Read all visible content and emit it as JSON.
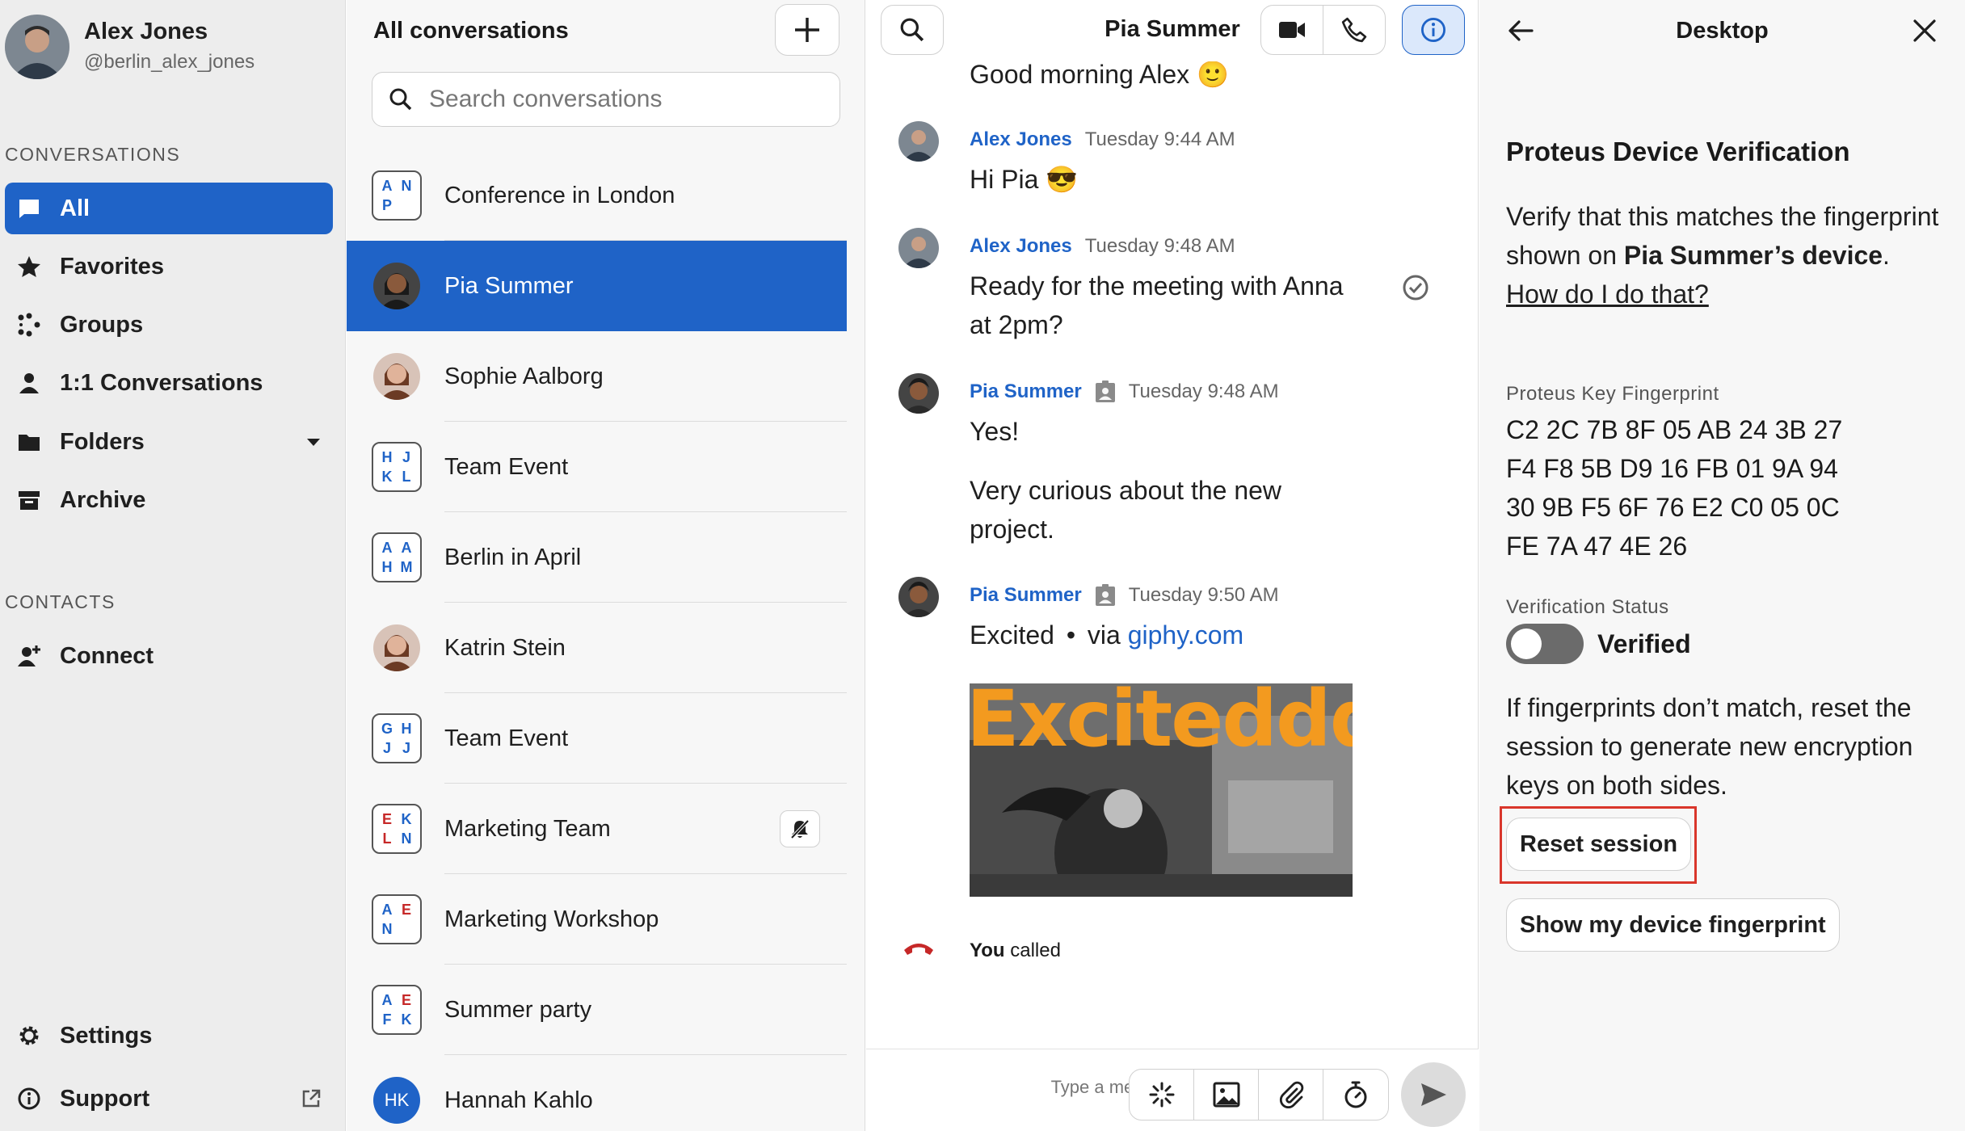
{
  "user": {
    "name": "Alex Jones",
    "handle": "@berlin_alex_jones"
  },
  "sidebar": {
    "conversations_label": "CONVERSATIONS",
    "items": [
      {
        "label": "All",
        "icon": "chat-bubble-icon",
        "active": true
      },
      {
        "label": "Favorites",
        "icon": "star-icon"
      },
      {
        "label": "Groups",
        "icon": "groups-icon"
      },
      {
        "label": "1:1 Conversations",
        "icon": "person-icon"
      },
      {
        "label": "Folders",
        "icon": "folder-icon"
      },
      {
        "label": "Archive",
        "icon": "archive-icon"
      }
    ],
    "contacts_label": "CONTACTS",
    "connect_label": "Connect",
    "settings_label": "Settings",
    "support_label": "Support"
  },
  "conversation_list": {
    "title": "All conversations",
    "search_placeholder": "Search conversations",
    "items": [
      {
        "name": "Conference in London",
        "type": "group",
        "initials": [
          "A",
          "N",
          "P",
          ""
        ],
        "colors": [
          "#1f63c7",
          "#1f63c7",
          "#1f63c7",
          "#1f63c7"
        ]
      },
      {
        "name": "Pia Summer",
        "type": "user",
        "active": true
      },
      {
        "name": "Sophie Aalborg",
        "type": "user"
      },
      {
        "name": "Team Event",
        "type": "group",
        "initials": [
          "H",
          "J",
          "K",
          "L"
        ],
        "colors": [
          "#1f63c7",
          "#1f63c7",
          "#1f63c7",
          "#1f63c7"
        ]
      },
      {
        "name": "Berlin in April",
        "type": "group",
        "initials": [
          "A",
          "A",
          "H",
          "M"
        ],
        "colors": [
          "#1f63c7",
          "#1f63c7",
          "#1f63c7",
          "#1f63c7"
        ]
      },
      {
        "name": "Katrin Stein",
        "type": "user"
      },
      {
        "name": "Team Event",
        "type": "group",
        "initials": [
          "G",
          "H",
          "J",
          "J"
        ],
        "colors": [
          "#1f63c7",
          "#1f63c7",
          "#1f63c7",
          "#1f63c7"
        ]
      },
      {
        "name": "Marketing Team",
        "type": "group",
        "initials": [
          "E",
          "K",
          "L",
          "N"
        ],
        "colors": [
          "#c62828",
          "#1f63c7",
          "#c62828",
          "#1f63c7"
        ],
        "muted": true
      },
      {
        "name": "Marketing Workshop",
        "type": "group",
        "initials": [
          "A",
          "E",
          "N",
          ""
        ],
        "colors": [
          "#1f63c7",
          "#c62828",
          "#1f63c7",
          "#1f63c7"
        ]
      },
      {
        "name": "Summer party",
        "type": "group",
        "initials": [
          "A",
          "E",
          "F",
          "K"
        ],
        "colors": [
          "#1f63c7",
          "#c62828",
          "#1f63c7",
          "#1f63c7"
        ]
      },
      {
        "name": "Hannah Kahlo",
        "type": "initials",
        "avatar_text": "HK"
      }
    ]
  },
  "chat": {
    "title": "Pia Summer",
    "partial_message": "Good morning Alex 🙂",
    "messages": [
      {
        "author": "Alex Jones",
        "time": "Tuesday 9:44 AM",
        "text": "Hi Pia 😎"
      },
      {
        "author": "Alex Jones",
        "time": "Tuesday 9:48 AM",
        "text_line1": "Ready for the meeting with Anna",
        "text_line2": "at 2pm?"
      },
      {
        "author": "Pia Summer",
        "time": "Tuesday 9:48 AM",
        "text": "Yes!",
        "text2_line1": "Very curious about the new",
        "text2_line2": "project."
      },
      {
        "author": "Pia Summer",
        "time": "Tuesday 9:50 AM",
        "text": "Excited",
        "via": "via",
        "link": "giphy.com",
        "gif_caption": "Exciteddd"
      }
    ],
    "call": {
      "you": "You",
      "label": "called"
    },
    "composer_placeholder": "Type a message"
  },
  "details": {
    "title": "Desktop",
    "heading": "Proteus Device Verification",
    "verify_pre": "Verify that this matches the fingerprint shown on",
    "verify_name": "Pia Summer’s device",
    "verify_post": ".",
    "how_link": "How do I do that?",
    "fingerprint_label": "Proteus Key Fingerprint",
    "fingerprint_lines": [
      "C2 2C 7B 8F 05 AB 24 3B 27",
      "F4 F8 5B D9 16 FB 01 9A 94",
      "30 9B F5 6F 76 E2 C0 05 0C",
      "FE 7A 47 4E 26"
    ],
    "status_label": "Verification Status",
    "verified_label": "Verified",
    "verified_on": false,
    "reset_info": "If fingerprints don’t match, reset the session to generate new encryption keys on both sides.",
    "reset_button": "Reset session",
    "show_fp_button": "Show my device fingerprint"
  },
  "colors": {
    "accent": "#1f63c7",
    "sidebar_bg": "#ededed",
    "highlight": "#d9362b"
  }
}
